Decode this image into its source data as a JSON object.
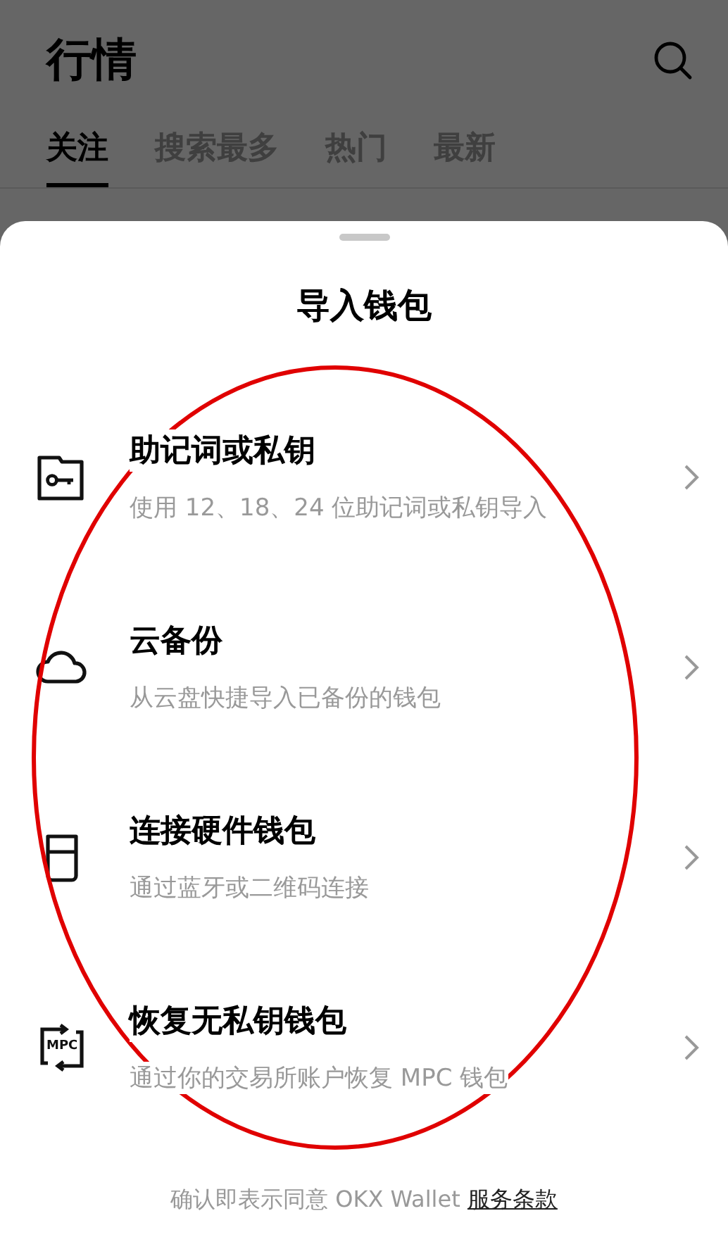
{
  "page": {
    "title": "行情"
  },
  "tabs": [
    {
      "label": "关注",
      "selected": true
    },
    {
      "label": "搜索最多",
      "selected": false
    },
    {
      "label": "热门",
      "selected": false
    },
    {
      "label": "最新",
      "selected": false
    }
  ],
  "sheet": {
    "title": "导入钱包",
    "options": [
      {
        "kind": "key",
        "title": "助记词或私钥",
        "subtitle": "使用 12、18、24 位助记词或私钥导入"
      },
      {
        "kind": "cloud",
        "title": "云备份",
        "subtitle": "从云盘快捷导入已备份的钱包"
      },
      {
        "kind": "hardware",
        "title": "连接硬件钱包",
        "subtitle": "通过蓝牙或二维码连接"
      },
      {
        "kind": "mpc",
        "icon_label": "MPC",
        "title": "恢复无私钥钱包",
        "subtitle": "通过你的交易所账户恢复 MPC 钱包"
      }
    ],
    "footer": {
      "text": "确认即表示同意 OKX Wallet",
      "link": "服务条款"
    }
  }
}
